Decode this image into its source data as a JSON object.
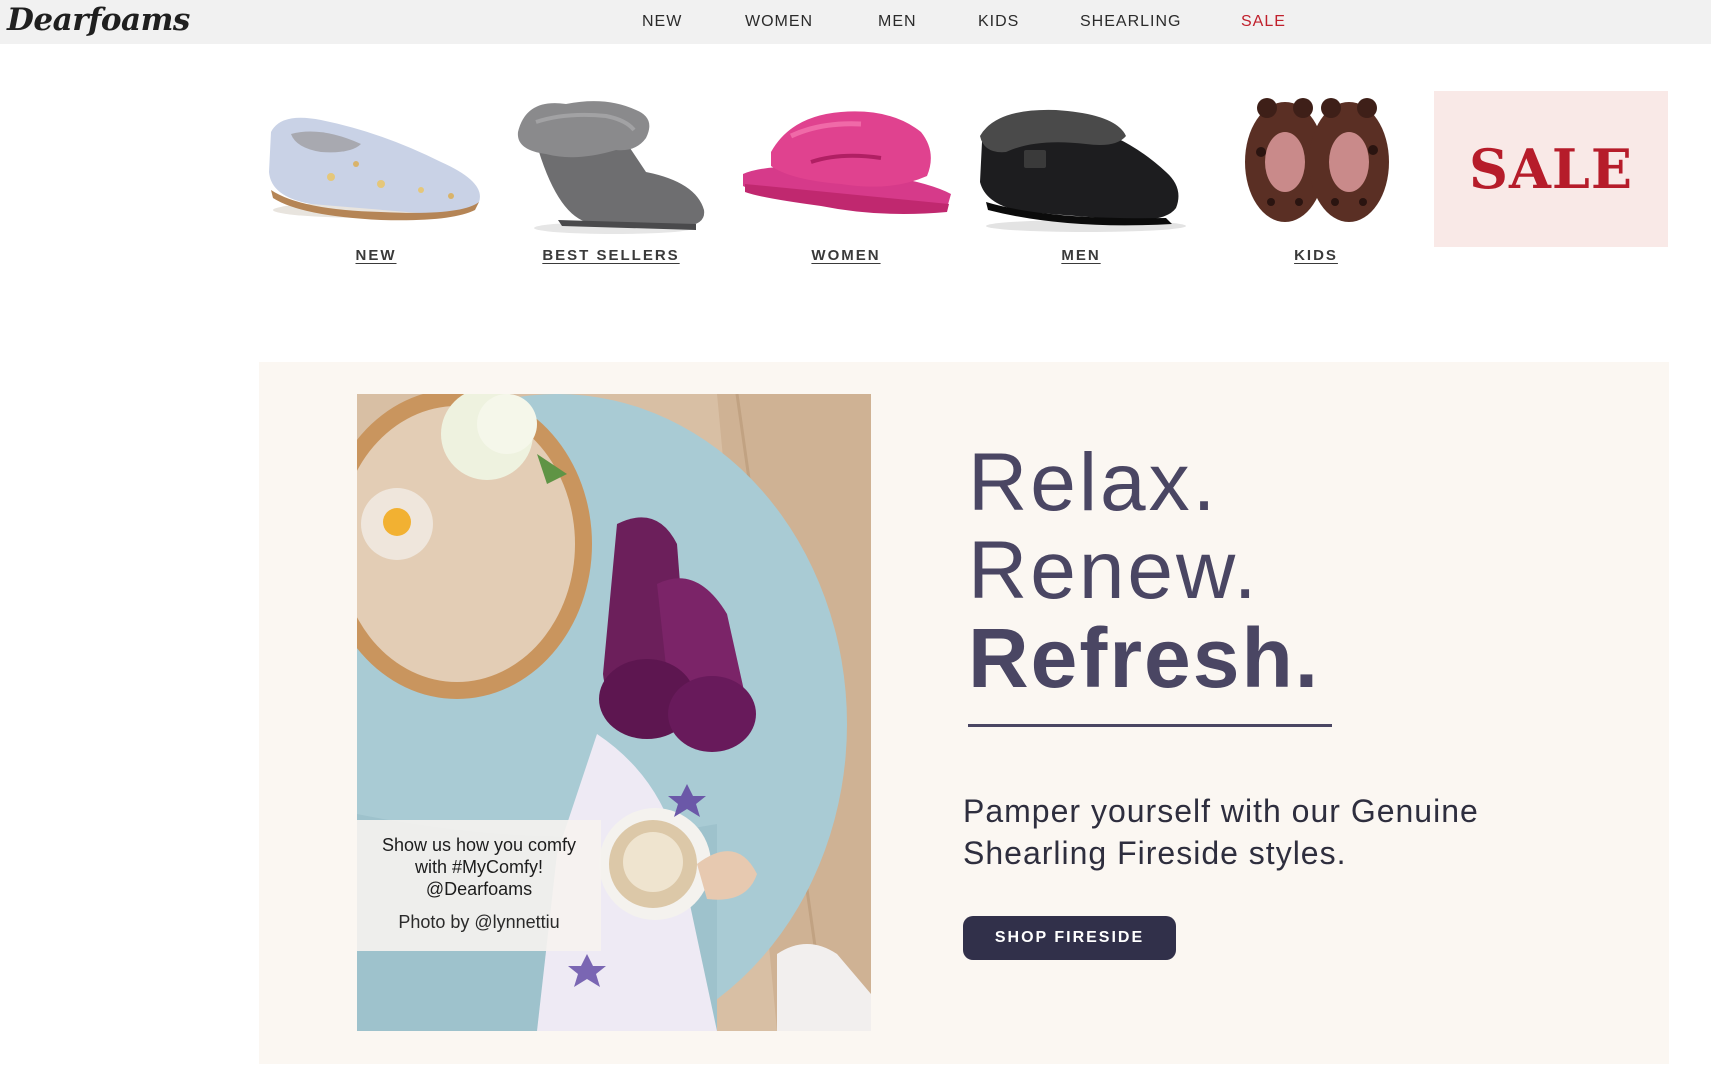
{
  "brand": {
    "logo_text": "Dearfoams"
  },
  "nav": {
    "items": [
      {
        "label": "NEW"
      },
      {
        "label": "WOMEN"
      },
      {
        "label": "MEN"
      },
      {
        "label": "KIDS"
      },
      {
        "label": "SHEARLING"
      },
      {
        "label": "SALE"
      }
    ]
  },
  "categories": [
    {
      "label": "NEW",
      "image": "floral-loafer-slipper"
    },
    {
      "label": "BEST SELLERS",
      "image": "gray-shearling-bootie"
    },
    {
      "label": "WOMEN",
      "image": "pink-fuzzy-slide"
    },
    {
      "label": "MEN",
      "image": "black-clog-slipper"
    },
    {
      "label": "KIDS",
      "image": "leopard-bear-slippers"
    }
  ],
  "sale_tile": {
    "text": "SALE"
  },
  "hero": {
    "headline": [
      "Relax.",
      "Renew.",
      "Refresh."
    ],
    "subtext": "Pamper yourself with our Genuine Shearling Fireside styles.",
    "cta_label": "SHOP FIRESIDE",
    "caption": {
      "line1": "Show us how you comfy with #MyComfy! @Dearfoams",
      "line2": "Photo by @lynnettiu"
    }
  },
  "colors": {
    "header_bg": "#f1f1f1",
    "sale_red": "#c0202c",
    "hero_bg": "#fbf7f2",
    "headline": "#4a4663",
    "cta_bg": "#31304a",
    "sale_tile_bg": "#f9e9e7"
  }
}
